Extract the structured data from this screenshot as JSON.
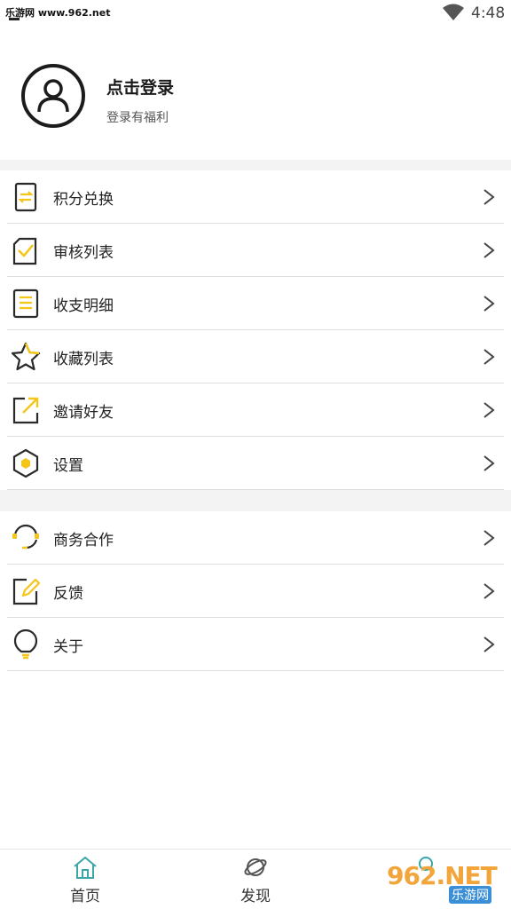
{
  "status_bar": {
    "carrier_text": "乐游网 www.962.net",
    "time": "4:48",
    "icons": [
      "wifi-icon"
    ]
  },
  "profile": {
    "avatar_icon": "user-icon",
    "title": "点击登录",
    "subtitle": "登录有福利"
  },
  "menu_group_1": [
    {
      "label": "积分兑换",
      "icon": "exchange-icon"
    },
    {
      "label": "审核列表",
      "icon": "review-list-icon"
    },
    {
      "label": "收支明细",
      "icon": "ledger-icon"
    },
    {
      "label": "收藏列表",
      "icon": "star-icon"
    },
    {
      "label": "邀请好友",
      "icon": "share-icon"
    },
    {
      "label": "设置",
      "icon": "settings-hexagon-icon"
    }
  ],
  "menu_group_2": [
    {
      "label": "商务合作",
      "icon": "headset-icon"
    },
    {
      "label": "反馈",
      "icon": "edit-icon"
    },
    {
      "label": "关于",
      "icon": "bulb-icon"
    }
  ],
  "bottom_nav": [
    {
      "label": "首页",
      "icon": "home-icon"
    },
    {
      "label": "发现",
      "icon": "planet-icon"
    },
    {
      "label": "",
      "icon": "profile-icon"
    }
  ],
  "watermark": {
    "text": "962.NET",
    "sub": "乐游网"
  },
  "colors": {
    "accent_yellow": "#f5c518",
    "icon_dark": "#2a2a2a",
    "nav_teal": "#3aa6a6",
    "divider": "#dedede",
    "gap_bg": "#f3f3f3"
  }
}
